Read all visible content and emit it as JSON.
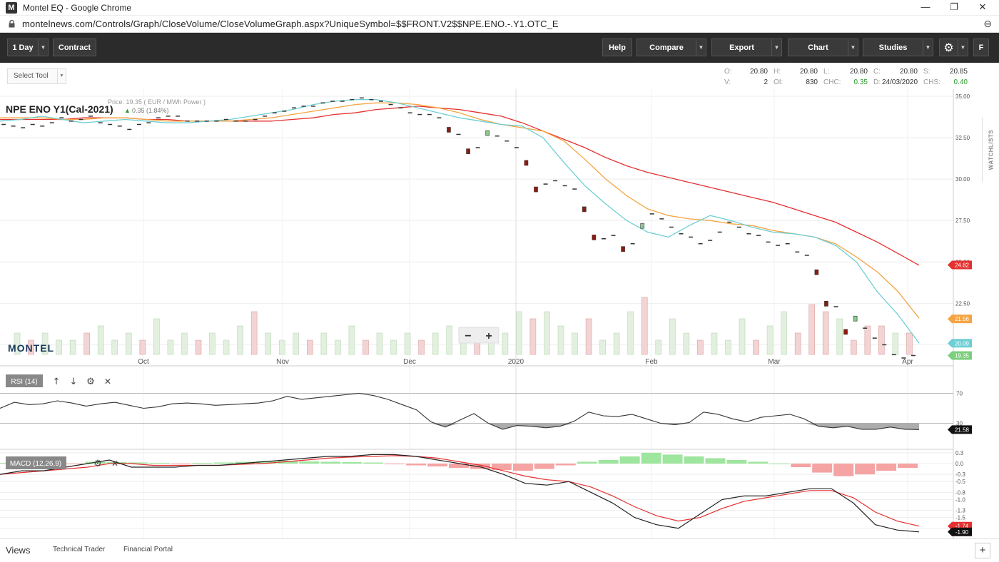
{
  "browser": {
    "title": "Montel EQ - Google Chrome",
    "url": "montelnews.com/Controls/Graph/CloseVolume/CloseVolumeGraph.aspx?UniqueSymbol=$$FRONT.V2$$NPE.ENO.-.Y1.OTC_E",
    "minimize": "—",
    "restore": "❐",
    "close": "✕",
    "zoom_icon": "⊖"
  },
  "toolbar": {
    "interval_label": "1 Day",
    "contract_label": "Contract",
    "help_label": "Help",
    "compare_label": "Compare",
    "export_label": "Export",
    "chart_label": "Chart",
    "studies_label": "Studies",
    "settings_icon": "⚙",
    "f_label": "F",
    "caret": "▼"
  },
  "select_tool": {
    "label": "Select Tool"
  },
  "ohlc": {
    "O": "20.80",
    "H": "20.80",
    "L": "20.80",
    "C": "20.80",
    "S": "20.85",
    "V": "2",
    "OI": "830",
    "CHC": "0.35",
    "D": "24/03/2020",
    "CHS": "0.40",
    "labels": {
      "O": "O:",
      "H": "H:",
      "L": "L:",
      "C": "C:",
      "S": "S:",
      "V": "V:",
      "OI": "OI:",
      "CHC": "CHC:",
      "D": "D:",
      "CHS": "CHS:"
    }
  },
  "watchlists_label": "WATCHLISTS",
  "chart_data": {
    "type": "line",
    "title": "NPE ENO Y1(Cal-2021)",
    "price_text": "Price: 19.35 ( EUR / MWh Power )",
    "change_text": "0.35 (1.84%)",
    "watermark": "MONTEL",
    "x_ticks": [
      "Oct",
      "Nov",
      "Dec",
      "2020",
      "Feb",
      "Mar",
      "Apr"
    ],
    "y_ticks": [
      "35.00",
      "32.50",
      "30.00",
      "27.50",
      "25.00",
      "22.50",
      "20.00"
    ],
    "ylim": [
      19.5,
      35.0
    ],
    "price_series": [
      33.3,
      33.2,
      33.1,
      33.3,
      33.2,
      33.4,
      33.7,
      33.5,
      33.6,
      33.8,
      33.4,
      33.3,
      33.2,
      33.0,
      33.3,
      33.4,
      33.7,
      33.8,
      33.8,
      33.5,
      33.5,
      33.5,
      33.5,
      33.6,
      33.5,
      33.5,
      33.6,
      33.8,
      34.0,
      34.1,
      34.3,
      34.4,
      34.4,
      34.6,
      34.7,
      34.7,
      34.8,
      34.9,
      34.8,
      34.7,
      34.5,
      34.3,
      34.0,
      33.9,
      33.9,
      33.7,
      33.0,
      32.7,
      31.7,
      31.9,
      32.8,
      32.6,
      32.3,
      31.9,
      31.0,
      29.4,
      29.7,
      29.9,
      29.6,
      29.4,
      28.2,
      26.5,
      26.4,
      26.6,
      25.8,
      26.1,
      27.2,
      27.9,
      27.6,
      27.1,
      26.7,
      26.5,
      26.1,
      26.3,
      26.8,
      27.4,
      27.1,
      26.7,
      26.6,
      26.2,
      26.0,
      26.1,
      25.6,
      25.4,
      24.4,
      22.5,
      22.3,
      20.8,
      21.6,
      21.0,
      20.4,
      20.0,
      19.4,
      19.2,
      19.35
    ],
    "series": [
      {
        "name": "red",
        "color": "#e53030",
        "values": [
          33.6,
          33.6,
          33.6,
          33.6,
          33.7,
          33.7,
          33.7,
          33.6,
          33.6,
          33.5,
          33.5,
          33.5,
          33.5,
          33.5,
          33.6,
          33.7,
          33.9,
          34.0,
          34.2,
          34.3,
          34.4,
          34.3,
          34.2,
          34.0,
          33.8,
          33.4,
          32.9,
          32.4,
          31.9,
          31.3,
          30.8,
          30.4,
          30.1,
          29.8,
          29.5,
          29.2,
          28.9,
          28.6,
          28.2,
          27.8,
          27.4,
          26.8,
          26.2,
          25.5,
          24.8
        ]
      },
      {
        "name": "orange",
        "color": "#f5a442",
        "values": [
          33.7,
          33.7,
          33.7,
          33.6,
          33.6,
          33.7,
          33.7,
          33.6,
          33.5,
          33.5,
          33.5,
          33.5,
          33.6,
          33.7,
          33.9,
          34.1,
          34.3,
          34.5,
          34.6,
          34.6,
          34.5,
          34.3,
          34.0,
          33.6,
          33.3,
          33.1,
          32.9,
          32.3,
          31.2,
          30.0,
          29.0,
          28.2,
          27.8,
          27.6,
          27.5,
          27.3,
          27.2,
          26.9,
          26.7,
          26.5,
          26.1,
          25.3,
          24.4,
          23.2,
          21.6
        ]
      },
      {
        "name": "cyan",
        "color": "#6ecfd4",
        "values": [
          33.5,
          33.6,
          33.8,
          33.6,
          33.4,
          33.5,
          33.6,
          33.5,
          33.4,
          33.4,
          33.5,
          33.6,
          33.8,
          34.0,
          34.2,
          34.5,
          34.7,
          34.8,
          34.8,
          34.6,
          34.3,
          34.0,
          33.7,
          33.5,
          33.3,
          33.2,
          32.5,
          31.0,
          29.6,
          28.5,
          27.5,
          26.8,
          26.5,
          27.2,
          27.8,
          27.5,
          27.1,
          26.8,
          26.7,
          26.5,
          26.0,
          25.0,
          23.2,
          21.8,
          20.1
        ]
      }
    ],
    "volume_bars": [
      3,
      2,
      3,
      2,
      2,
      3,
      4,
      2,
      3,
      2,
      5,
      2,
      3,
      2,
      3,
      2,
      4,
      6,
      3,
      2,
      3,
      2,
      3,
      2,
      4,
      2,
      3,
      2,
      3,
      2,
      3,
      4,
      2,
      3,
      2,
      3,
      6,
      5,
      6,
      4,
      3,
      5,
      2,
      3,
      6,
      8,
      2,
      5,
      3,
      2,
      3,
      2,
      5,
      2,
      4,
      6,
      3,
      7,
      6,
      5,
      2,
      4,
      4,
      3,
      3
    ],
    "last_labels": [
      {
        "text": "24.82",
        "color": "#e53030",
        "value": 24.82
      },
      {
        "text": "21.56",
        "color": "#f5a442",
        "value": 21.56
      },
      {
        "text": "20.09",
        "color": "#6ecfd4",
        "value": 20.09
      },
      {
        "text": "19.35",
        "color": "#7ccf7c",
        "value": 19.35
      }
    ]
  },
  "rsi": {
    "label": "RSI (14)",
    "up_icon": "↑",
    "down_icon": "↓",
    "settings_icon": "⚙",
    "close_icon": "✕",
    "levels": [
      "70",
      "30"
    ],
    "last": "21.58",
    "values": [
      50,
      58,
      55,
      56,
      60,
      57,
      53,
      56,
      58,
      54,
      50,
      52,
      56,
      57,
      56,
      54,
      55,
      56,
      57,
      60,
      66,
      62,
      64,
      66,
      68,
      70,
      67,
      62,
      55,
      48,
      32,
      25,
      34,
      43,
      30,
      22,
      27,
      26,
      24,
      26,
      33,
      45,
      40,
      39,
      42,
      36,
      30,
      28,
      31,
      45,
      42,
      36,
      32,
      38,
      40,
      42,
      36,
      26,
      24,
      26,
      22,
      22,
      25,
      22,
      21.58
    ]
  },
  "macd": {
    "label": "MACD (12,26,9)",
    "settings_icon": "⚙",
    "close_icon": "✕",
    "ticks": [
      "0.3",
      "0.0",
      "-0.3",
      "-0.5",
      "-0.8",
      "-1.0",
      "-1.3",
      "-1.5",
      "-1.8"
    ],
    "last_signal": "-1.74",
    "last_macd": "-1.90",
    "macd_line": [
      -0.3,
      -0.2,
      -0.2,
      -0.1,
      0.0,
      0.1,
      -0.1,
      -0.1,
      -0.1,
      -0.05,
      -0.05,
      0.0,
      0.05,
      0.1,
      0.15,
      0.2,
      0.2,
      0.25,
      0.25,
      0.2,
      0.1,
      0.0,
      -0.1,
      -0.3,
      -0.55,
      -0.6,
      -0.5,
      -0.8,
      -1.1,
      -1.5,
      -1.7,
      -1.8,
      -1.4,
      -1.0,
      -0.9,
      -0.9,
      -0.8,
      -0.7,
      -0.7,
      -1.1,
      -1.7,
      -1.85,
      -1.9
    ],
    "signal_line": [
      -0.3,
      -0.25,
      -0.2,
      -0.15,
      -0.1,
      0.0,
      0.0,
      -0.05,
      -0.05,
      -0.05,
      -0.05,
      -0.02,
      0.0,
      0.05,
      0.1,
      0.15,
      0.18,
      0.2,
      0.22,
      0.2,
      0.15,
      0.05,
      -0.05,
      -0.2,
      -0.35,
      -0.45,
      -0.5,
      -0.65,
      -0.9,
      -1.2,
      -1.45,
      -1.6,
      -1.5,
      -1.25,
      -1.05,
      -0.95,
      -0.85,
      -0.75,
      -0.75,
      -0.95,
      -1.35,
      -1.6,
      -1.74
    ],
    "histogram": [
      0.02,
      0.03,
      0.02,
      -0.02,
      0.05,
      0.04,
      0.03,
      0.02,
      -0.02,
      0.02,
      0.03,
      0.05,
      0.07,
      0.08,
      0.06,
      0.05,
      0.04,
      0.03,
      -0.02,
      -0.05,
      -0.08,
      -0.12,
      -0.15,
      -0.18,
      -0.2,
      -0.15,
      -0.05,
      0.05,
      0.1,
      0.2,
      0.3,
      0.25,
      0.2,
      0.15,
      0.1,
      0.05,
      0.0,
      -0.1,
      -0.25,
      -0.35,
      -0.3,
      -0.2,
      -0.12
    ]
  },
  "views": {
    "label": "Views",
    "tab1": "Technical Trader",
    "tab2": "Financial Portal",
    "add": "+"
  },
  "zoom_controls": {
    "minus": "−",
    "plus": "+"
  }
}
